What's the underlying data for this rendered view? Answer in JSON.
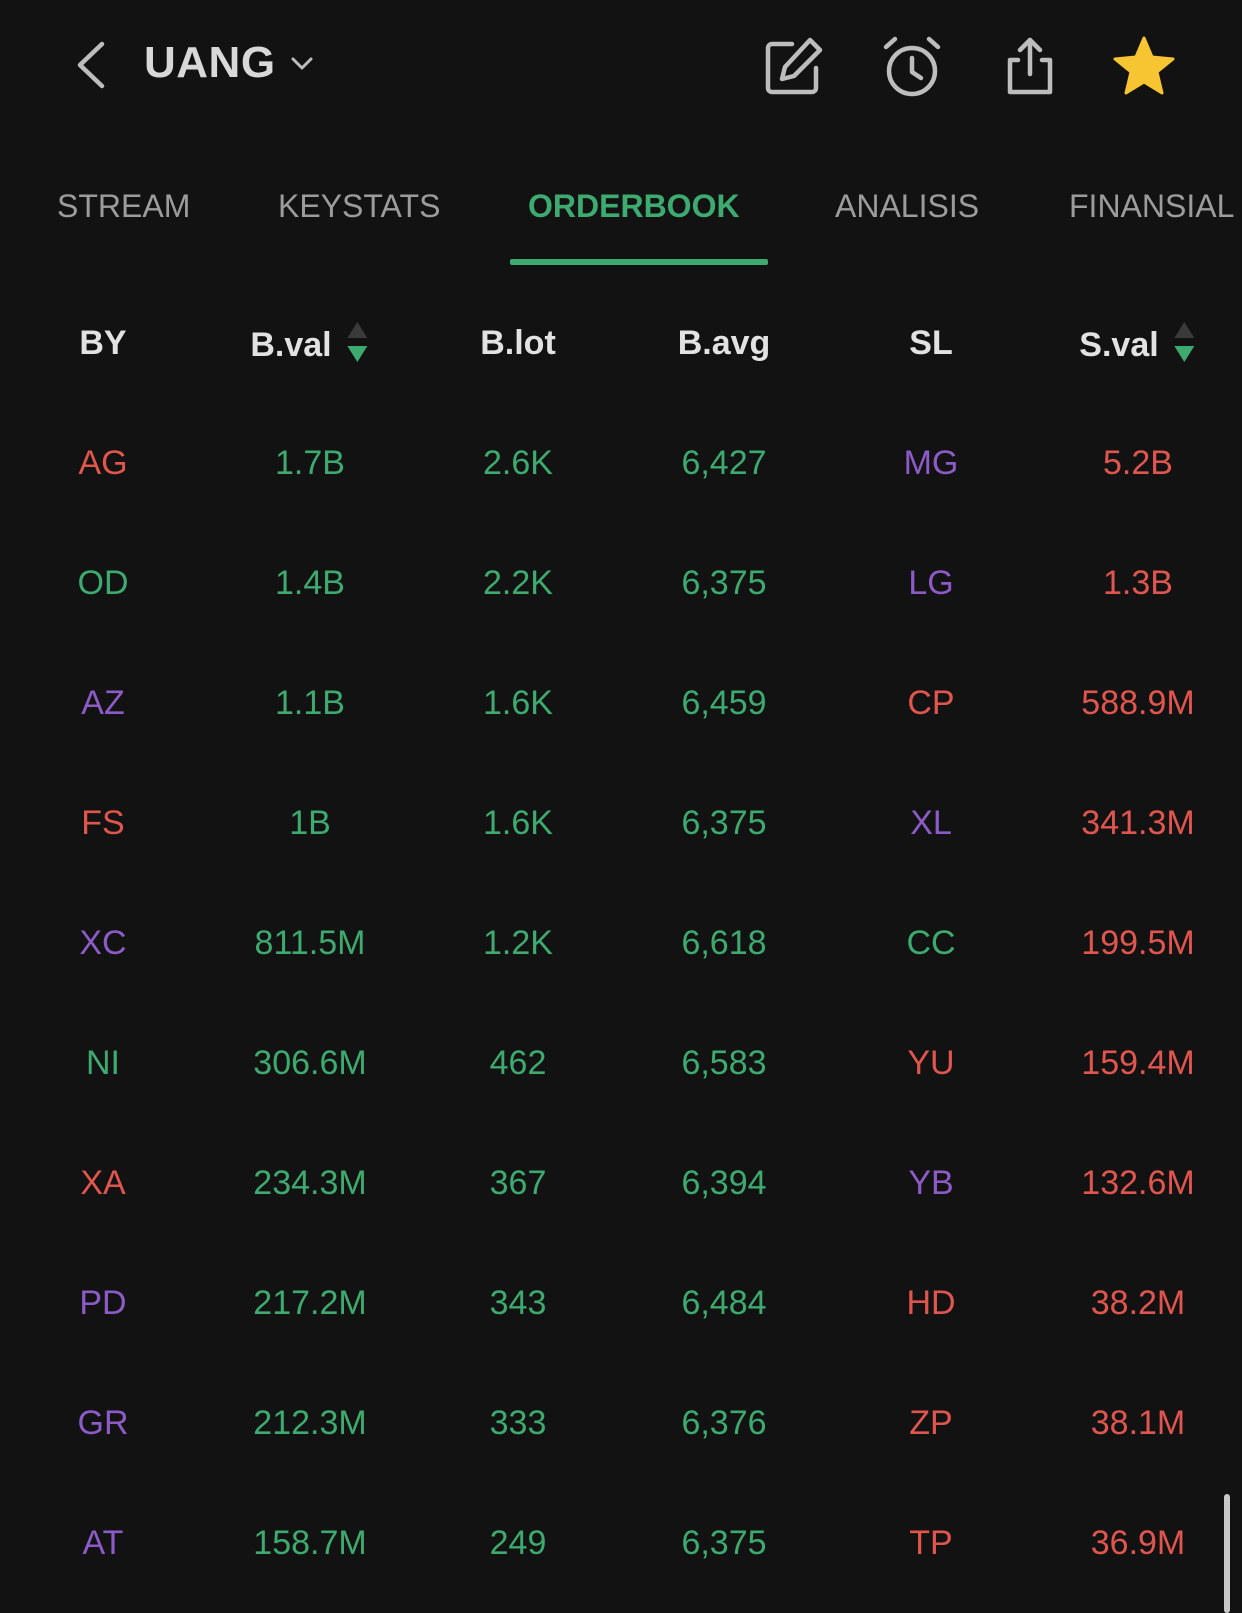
{
  "header": {
    "title": "UANG",
    "icons": [
      "back-chevron-icon",
      "dropdown-chevron-icon",
      "edit-icon",
      "alarm-clock-icon",
      "share-icon",
      "star-icon"
    ],
    "star_color": "#F7C531"
  },
  "tabs": [
    {
      "label": "STREAM",
      "active": false
    },
    {
      "label": "KEYSTATS",
      "active": false
    },
    {
      "label": "ORDERBOOK",
      "active": true
    },
    {
      "label": "ANALISIS",
      "active": false
    },
    {
      "label": "FINANSIAL",
      "active": false
    }
  ],
  "columns": [
    "BY",
    "B.val",
    "B.lot",
    "B.avg",
    "SL",
    "S.val"
  ],
  "colors": {
    "green": "#3DAA6F",
    "red": "#E0564E",
    "purple": "#8C5BC7",
    "accent": "#3DAA6F"
  },
  "rows": [
    {
      "by": "AG",
      "by_color": "red",
      "bval": "1.7B",
      "blot": "2.6K",
      "bavg": "6,427",
      "sl": "MG",
      "sl_color": "purple",
      "sval": "5.2B"
    },
    {
      "by": "OD",
      "by_color": "green",
      "bval": "1.4B",
      "blot": "2.2K",
      "bavg": "6,375",
      "sl": "LG",
      "sl_color": "purple",
      "sval": "1.3B"
    },
    {
      "by": "AZ",
      "by_color": "purple",
      "bval": "1.1B",
      "blot": "1.6K",
      "bavg": "6,459",
      "sl": "CP",
      "sl_color": "red",
      "sval": "588.9M"
    },
    {
      "by": "FS",
      "by_color": "red",
      "bval": "1B",
      "blot": "1.6K",
      "bavg": "6,375",
      "sl": "XL",
      "sl_color": "purple",
      "sval": "341.3M"
    },
    {
      "by": "XC",
      "by_color": "purple",
      "bval": "811.5M",
      "blot": "1.2K",
      "bavg": "6,618",
      "sl": "CC",
      "sl_color": "green",
      "sval": "199.5M"
    },
    {
      "by": "NI",
      "by_color": "green",
      "bval": "306.6M",
      "blot": "462",
      "bavg": "6,583",
      "sl": "YU",
      "sl_color": "red",
      "sval": "159.4M"
    },
    {
      "by": "XA",
      "by_color": "red",
      "bval": "234.3M",
      "blot": "367",
      "bavg": "6,394",
      "sl": "YB",
      "sl_color": "purple",
      "sval": "132.6M"
    },
    {
      "by": "PD",
      "by_color": "purple",
      "bval": "217.2M",
      "blot": "343",
      "bavg": "6,484",
      "sl": "HD",
      "sl_color": "red",
      "sval": "38.2M"
    },
    {
      "by": "GR",
      "by_color": "purple",
      "bval": "212.3M",
      "blot": "333",
      "bavg": "6,376",
      "sl": "ZP",
      "sl_color": "red",
      "sval": "38.1M"
    },
    {
      "by": "AT",
      "by_color": "purple",
      "bval": "158.7M",
      "blot": "249",
      "bavg": "6,375",
      "sl": "TP",
      "sl_color": "red",
      "sval": "36.9M"
    }
  ]
}
